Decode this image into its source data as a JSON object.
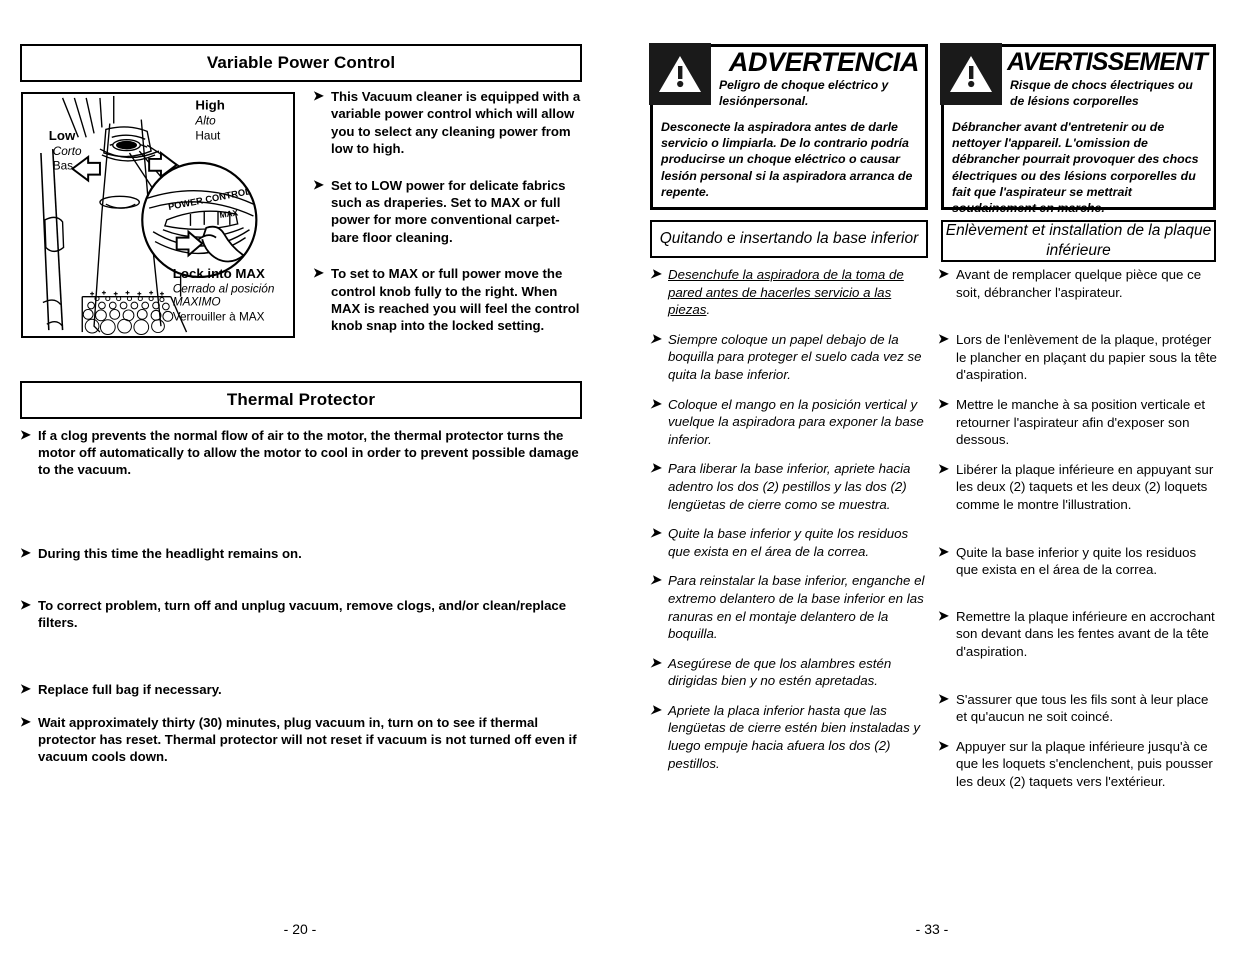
{
  "left_page": {
    "sections": [
      {
        "id": "variable-power-control",
        "title": "Variable Power Control",
        "figure": {
          "labels": {
            "low": {
              "en": "Low",
              "es": "Corto",
              "fr": "Bas"
            },
            "high": {
              "en": "High",
              "es": "Alto",
              "fr": "Haut"
            },
            "lock": {
              "en": "Lock into MAX",
              "es": "Cerrado al posición MAXIMO",
              "es_line1": "Cerrado al posición",
              "es_line2": "MAXIMO",
              "fr": "Verrouiller à MAX"
            }
          },
          "knob_text": {
            "main": "POWER CONTROL",
            "max": "MAX"
          }
        },
        "bullets": [
          "This Vacuum cleaner is equipped with a variable power control which will allow you to select any cleaning power from low to high.",
          "Set to LOW power for delicate fabrics such as draperies. Set to MAX or full power for more conventional carpet-bare floor cleaning.",
          "To set to MAX or full power move the control knob fully to the right. When MAX is reached you will feel the control knob snap into the locked setting."
        ]
      },
      {
        "id": "thermal-protector",
        "title": "Thermal Protector",
        "bullets": [
          "If a clog prevents the normal flow of air to the motor, the thermal protector turns the motor off automatically to allow the motor to cool in order to prevent possible damage to the vacuum.",
          "During this time the headlight remains on.",
          "To correct problem, turn off and unplug vacuum, remove clogs, and/or clean/replace filters.",
          "Replace full bag if necessary.",
          "Wait approximately thirty (30) minutes, plug vacuum in, turn on to see if thermal protector has reset. Thermal protector will not reset if vacuum is not turned off even if vacuum cools down."
        ]
      }
    ],
    "folio": "- 20 -"
  },
  "right_page": {
    "warning_es": {
      "icon": "warning-triangle-icon",
      "word": "ADVERTENCIA",
      "subtitle": "Peligro de choque eléctrico y lesiónpersonal.",
      "body": "Desconecte la aspiradora antes de darle servicio o limpiarla. De lo contrario podría producirse un choque eléctrico o causar lesión personal si la aspiradora arranca de repente."
    },
    "warning_fr": {
      "icon": "warning-triangle-icon",
      "word": "AVERTISSEMENT",
      "subtitle": "Risque de chocs électriques ou de lésions corporelles",
      "body": "Débrancher avant d'entretenir ou de nettoyer l'appareil. L'omission de débrancher pourrait provoquer des chocs électriques ou des lésions corporelles du fait que l'aspirateur se mettrait soudainement en marche."
    },
    "section_es": {
      "title": "Quitando e insertando la base inferior",
      "bullets": [
        {
          "underlined": "Desenchufe la aspiradora de la toma de pared antes de hacerles servicio a las piezas",
          "tail": "."
        },
        {
          "text": "Siempre coloque un papel debajo de la boquilla para proteger el suelo cada vez se quita la base inferior."
        },
        {
          "text": "Coloque el mango en la posición vertical y vuelque la aspiradora para exponer la base inferior."
        },
        {
          "text": "Para liberar la base inferior, apriete hacia adentro los dos (2) pestillos y las dos (2) lengüetas de cierre como se muestra."
        },
        {
          "text": "Quite la base inferior y quite los residuos que exista en el área de la correa."
        },
        {
          "text": "Para reinstalar la base inferior, enganche el extremo delantero de la base inferior en las ranuras en el montaje delantero de la boquilla."
        },
        {
          "text": "Asegúrese de que los alambres estén dirigidas bien y no estén apretadas."
        },
        {
          "text": "Apriete la placa inferior hasta que las lengüetas de cierre estén bien instaladas y luego empuje hacia afuera los dos (2) pestillos."
        }
      ]
    },
    "section_fr": {
      "title": "Enlèvement et installation de la plaque inférieure",
      "bullets": [
        {
          "text": "Avant de remplacer quelque pièce que ce soit, débrancher l'aspirateur."
        },
        {
          "text": "Lors de l'enlèvement de la plaque, protéger le plancher en plaçant du papier sous la tête d'aspiration."
        },
        {
          "text": "Mettre le manche à sa position verticale et retourner l'aspirateur afin d'exposer son dessous."
        },
        {
          "text": "Libérer la plaque inférieure en appuyant sur les deux (2) taquets et les deux (2) loquets comme le montre l'illustration."
        },
        {
          "text": "Quite la base inferior y quite los residuos que exista en el área de la correa."
        },
        {
          "text": "Remettre la plaque inférieure en accrochant son devant dans les fentes avant de la tête d'aspiration."
        },
        {
          "text": "S'assurer que tous les fils sont à leur place et qu'aucun ne soit coincé."
        },
        {
          "text": "Appuyer sur la plaque inférieure jusqu'à ce que les loquets s'enclenchent, puis pousser les deux (2) taquets vers l'extérieur."
        }
      ]
    },
    "folio": "- 33 -"
  }
}
